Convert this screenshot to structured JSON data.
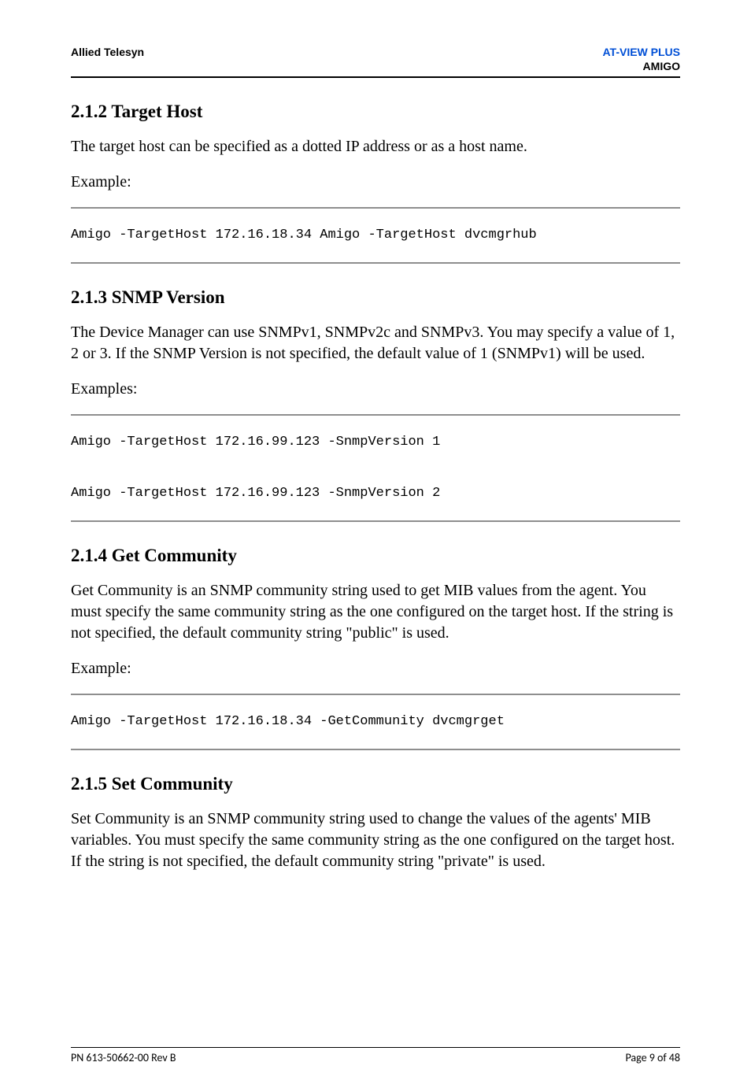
{
  "header": {
    "left": "Allied Telesyn",
    "right_line1": "AT-VIEW PLUS",
    "right_line2": "AMIGO"
  },
  "sections": {
    "s212": {
      "heading": "2.1.2 Target Host",
      "para1": "The target host can be specified as a dotted IP address or as a host name.",
      "example_label": "Example:",
      "code": "Amigo -TargetHost 172.16.18.34 Amigo -TargetHost dvcmgrhub"
    },
    "s213": {
      "heading": "2.1.3 SNMP Version",
      "para1": "The Device Manager can use SNMPv1, SNMPv2c and SNMPv3. You may specify a value of 1, 2 or 3. If the SNMP Version is not specified, the default value of 1 (SNMPv1) will be used.",
      "examples_label": "Examples:",
      "code": "Amigo -TargetHost 172.16.99.123 -SnmpVersion 1\n\nAmigo -TargetHost 172.16.99.123 -SnmpVersion 2"
    },
    "s214": {
      "heading": "2.1.4 Get Community",
      "para1": "Get Community is an SNMP community string used to get MIB values from the agent. You must specify the same community string as the one configured on the target host. If the string is not specified, the default community string \"public\" is used.",
      "example_label": "Example:",
      "code": "Amigo -TargetHost 172.16.18.34 -GetCommunity dvcmgrget"
    },
    "s215": {
      "heading": "2.1.5 Set Community",
      "para1": "Set Community is an SNMP community string used to change the values of the agents' MIB variables. You must specify the same community string as the one configured on the target host. If the string is not specified, the default community string \"private\" is used."
    }
  },
  "footer": {
    "left": "PN 613-50662-00 Rev B",
    "right": "Page 9 of 48"
  }
}
